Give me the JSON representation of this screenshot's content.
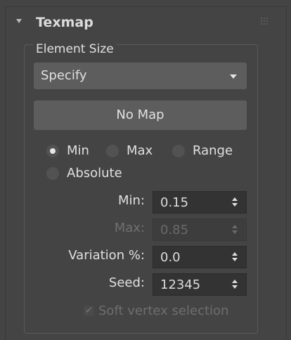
{
  "rollout": {
    "title": "Texmap",
    "group_label": "Element Size",
    "element_size_dropdown": {
      "selected": "Specify"
    },
    "map_button_label": "No Map",
    "radio_options": [
      {
        "label": "Min",
        "checked": true
      },
      {
        "label": "Max",
        "checked": false
      },
      {
        "label": "Range",
        "checked": false
      },
      {
        "label": "Absolute",
        "checked": false
      }
    ],
    "fields": {
      "min": {
        "label": "Min:",
        "value": "0.15",
        "enabled": true
      },
      "max": {
        "label": "Max:",
        "value": "0.85",
        "enabled": false
      },
      "variation": {
        "label": "Variation %:",
        "value": "0.0",
        "enabled": true
      },
      "seed": {
        "label": "Seed:",
        "value": "12345",
        "enabled": true
      }
    },
    "soft_vertex_selection": {
      "label": "Soft vertex selection",
      "checked": true,
      "enabled": false
    }
  },
  "colors": {
    "panel_background": "#444444",
    "control_background": "#5d5d5d",
    "spinner_background": "#333333",
    "text": "#e0e0e0",
    "disabled_text": "#6e6e6e"
  },
  "icons": [
    "collapse-arrow-icon",
    "grip-icon",
    "dropdown-arrow-icon",
    "spinner-arrows-icon",
    "checkmark-icon"
  ]
}
